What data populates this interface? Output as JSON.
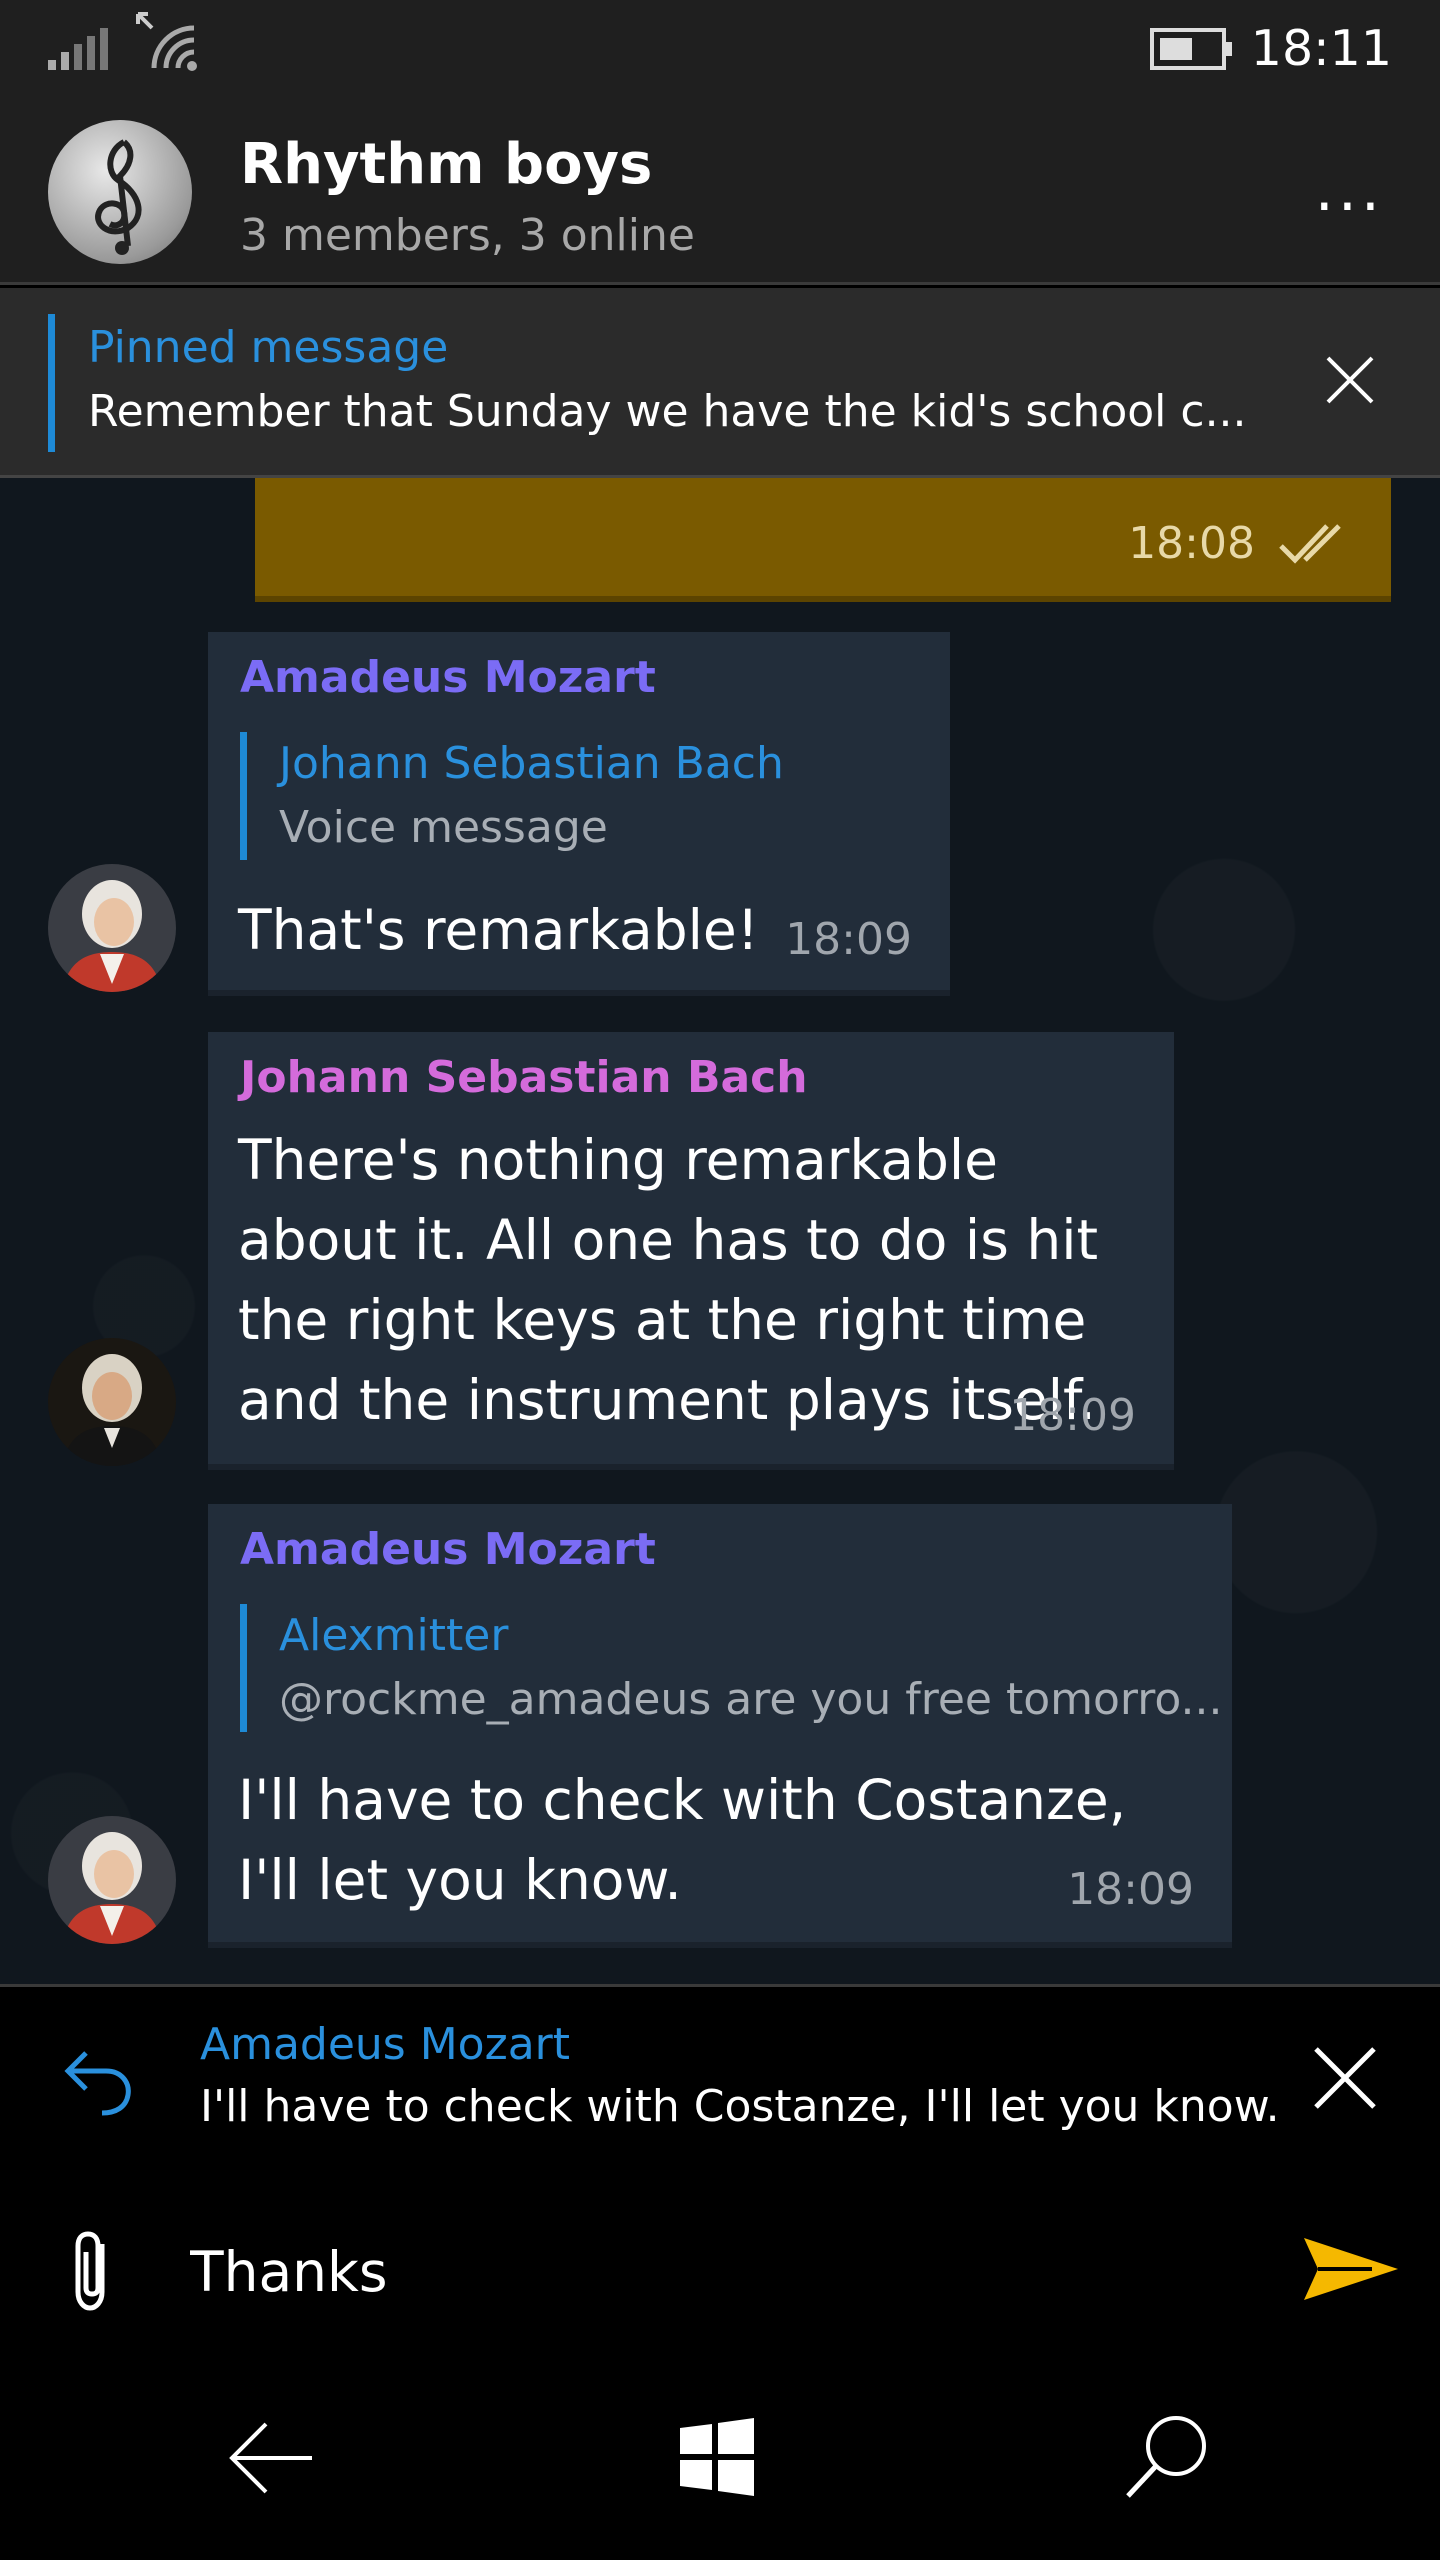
{
  "status_bar": {
    "time": "18:11"
  },
  "header": {
    "title": "Rhythm boys",
    "subtitle": "3 members, 3 online",
    "menu": "..."
  },
  "pinned": {
    "title": "Pinned message",
    "text": "Remember that Sunday we have the kid's school c..."
  },
  "messages": [
    {
      "own": true,
      "time": "18:08",
      "status_icon": "double-check-icon"
    },
    {
      "sender": "Amadeus Mozart",
      "sender_color": "#7b6cf5",
      "reply_to": "Johann Sebastian Bach",
      "reply_text": "Voice message",
      "text": "That's remarkable!",
      "time": "18:09"
    },
    {
      "sender": "Johann Sebastian Bach",
      "sender_color": "#d46bdb",
      "text": "There's nothing remarkable about it. All one has to do is hit the right keys at the right time and the instrument plays itself.",
      "time": "18:09"
    },
    {
      "sender": "Amadeus Mozart",
      "sender_color": "#7b6cf5",
      "reply_to": "Alexmitter",
      "reply_text": "@rockme_amadeus are you free tomorro...",
      "text": "I'll have to check with Costanze, I'll let you know.",
      "time": "18:09"
    }
  ],
  "reply_bar": {
    "name": "Amadeus Mozart",
    "text": "I'll have to check with Costanze, I'll let you know."
  },
  "input": {
    "value": "Thanks"
  },
  "colors": {
    "accent": "#1e8ad6",
    "own_bubble": "#7a5a00",
    "send": "#f5b800"
  }
}
